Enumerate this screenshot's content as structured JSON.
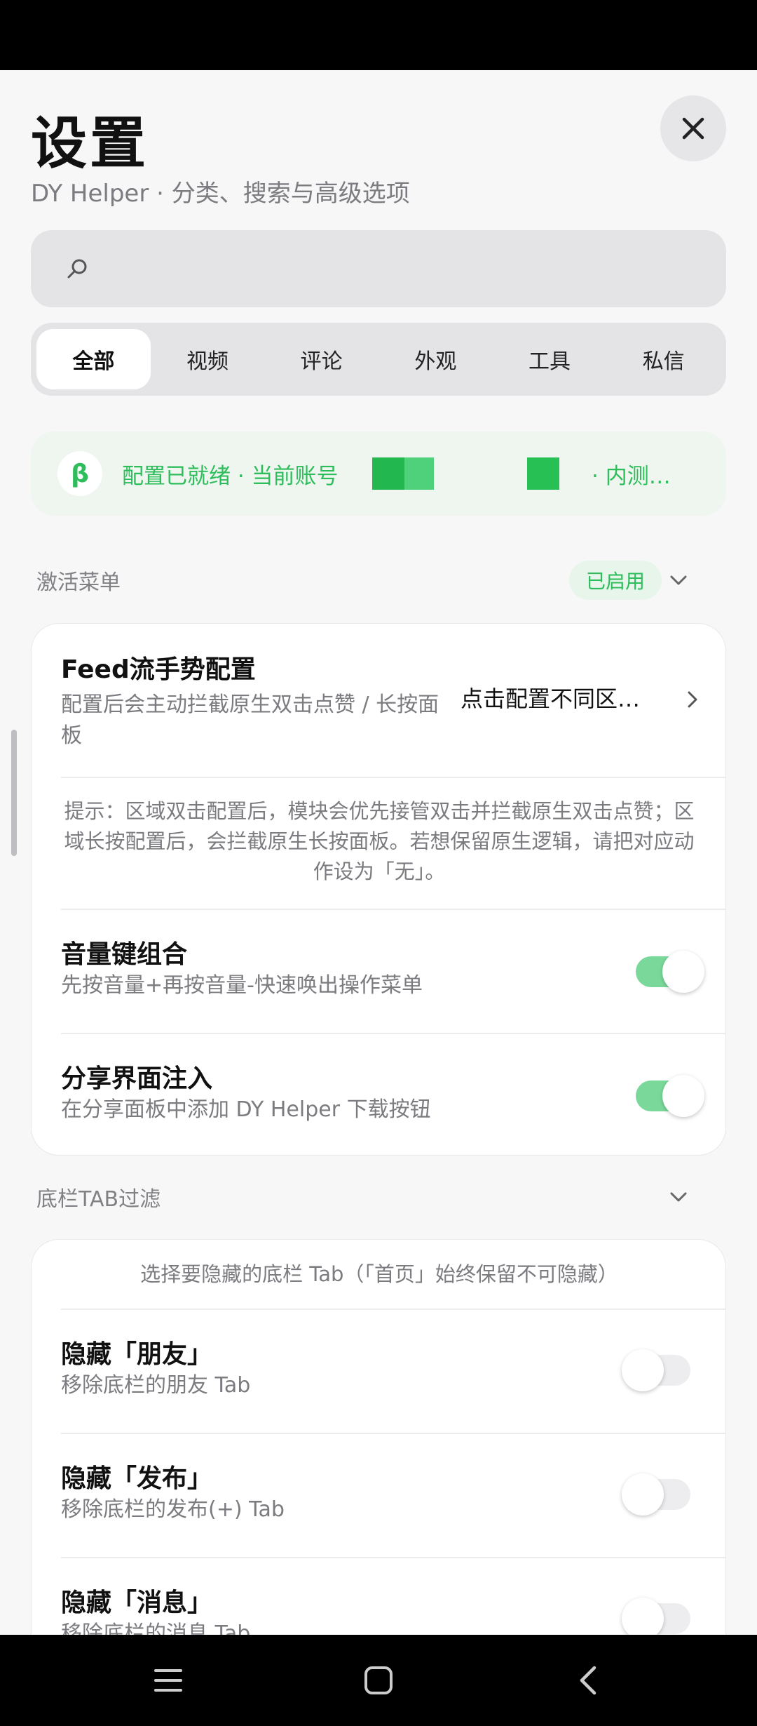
{
  "header": {
    "title": "设置",
    "subtitle": "DY Helper · 分类、搜索与高级选项"
  },
  "search": {
    "placeholder": ""
  },
  "tabs": [
    {
      "label": "全部",
      "active": true
    },
    {
      "label": "视频",
      "active": false
    },
    {
      "label": "评论",
      "active": false
    },
    {
      "label": "外观",
      "active": false
    },
    {
      "label": "工具",
      "active": false
    },
    {
      "label": "私信",
      "active": false
    }
  ],
  "banner": {
    "badge": "β",
    "text": "配置已就绪 · 当前账号",
    "tail": "· 内测…",
    "accent": "#2EBD5B"
  },
  "sections": [
    {
      "title": "激活菜单",
      "badge": "已启用",
      "rows": [
        {
          "title": "Feed流手势配置",
          "desc": "配置后会主动拦截原生双击点赞 / 长按面板",
          "value": "点击配置不同区…"
        },
        {
          "hint": "提示：区域双击配置后，模块会优先接管双击并拦截原生双击点赞；区域长按配置后，会拦截原生长按面板。若想保留原生逻辑，请把对应动作设为「无」。"
        },
        {
          "title": "音量键组合",
          "desc": "先按音量+再按音量-快速唤出操作菜单",
          "enabled": true
        },
        {
          "title": "分享界面注入",
          "desc": "在分享面板中添加 DY Helper 下载按钮",
          "enabled": true
        }
      ]
    },
    {
      "title": "底栏TAB过滤",
      "hint": "选择要隐藏的底栏 Tab（「首页」始终保留不可隐藏）",
      "rows": [
        {
          "title": "隐藏「朋友」",
          "desc": "移除底栏的朋友 Tab",
          "enabled": false
        },
        {
          "title": "隐藏「发布」",
          "desc": "移除底栏的发布(+) Tab",
          "enabled": false
        },
        {
          "title": "隐藏「消息」",
          "desc": "移除底栏的消息 Tab",
          "enabled": false
        }
      ]
    }
  ],
  "icons": {
    "close": "close-icon",
    "search": "search-icon",
    "chevron": "chevron-down-icon",
    "arrow": "chevron-right-icon",
    "nav": [
      "menu-icon",
      "home-square-icon",
      "back-icon"
    ]
  }
}
